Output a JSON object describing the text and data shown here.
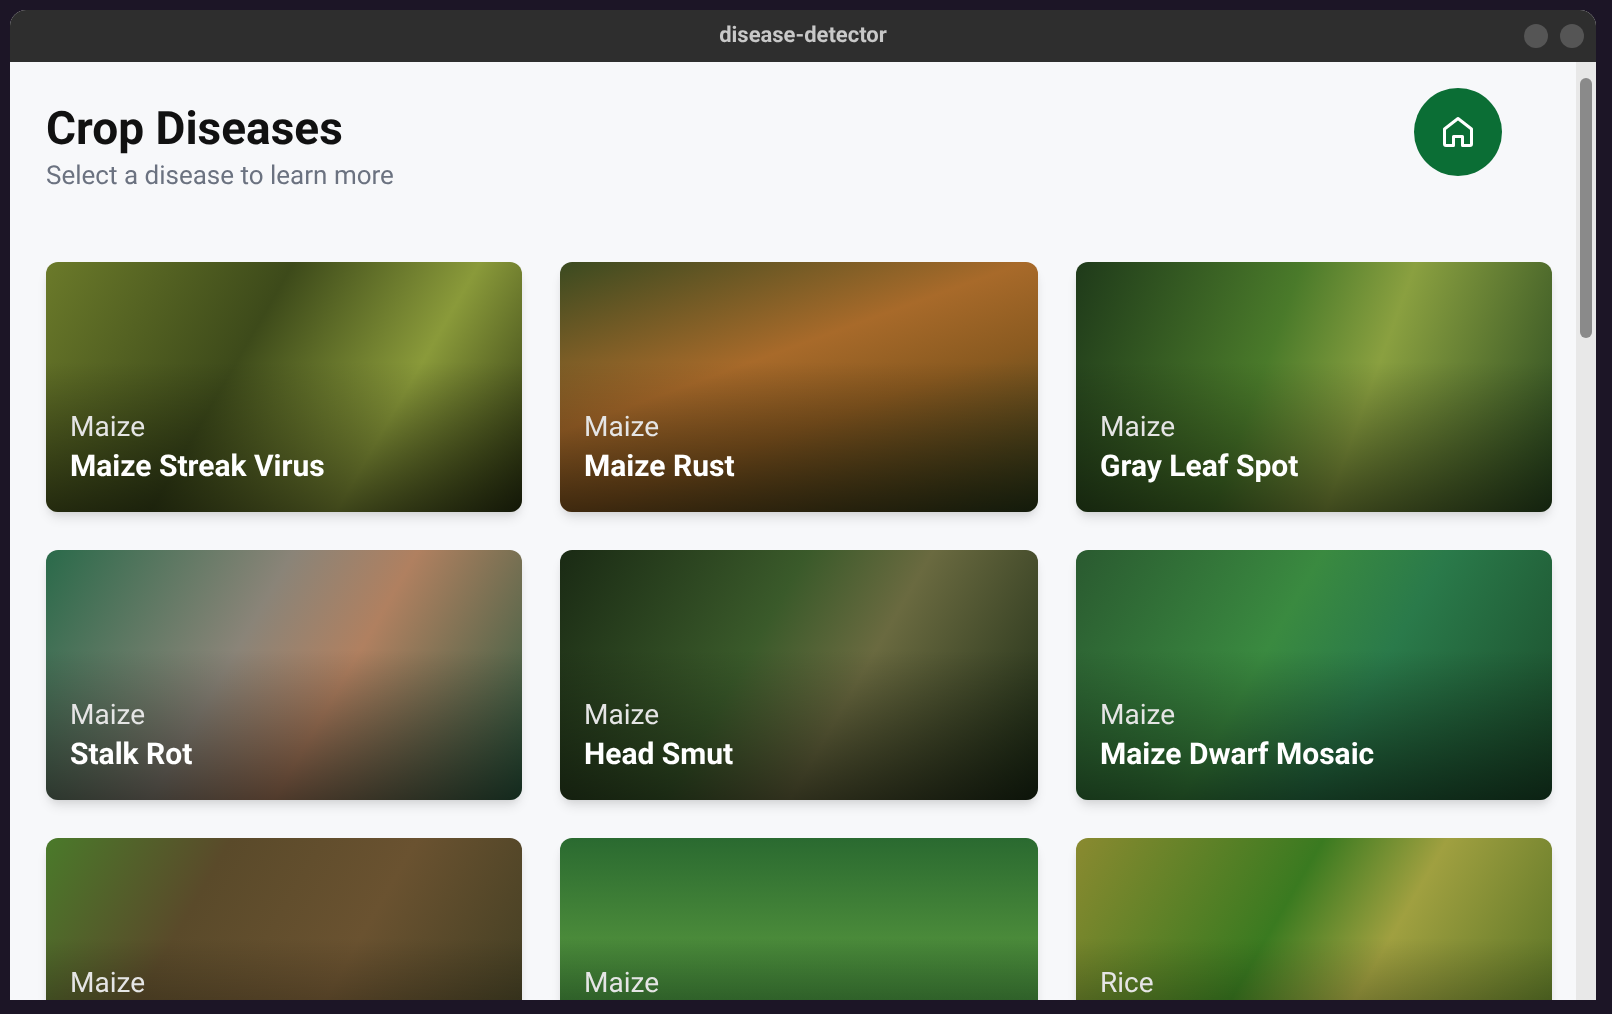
{
  "window": {
    "title": "disease-detector"
  },
  "header": {
    "title": "Crop Diseases",
    "subtitle": "Select a disease to learn more"
  },
  "cards": [
    {
      "crop": "Maize",
      "name": "Maize Streak Virus"
    },
    {
      "crop": "Maize",
      "name": "Maize Rust"
    },
    {
      "crop": "Maize",
      "name": "Gray Leaf Spot"
    },
    {
      "crop": "Maize",
      "name": "Stalk Rot"
    },
    {
      "crop": "Maize",
      "name": "Head Smut"
    },
    {
      "crop": "Maize",
      "name": "Maize Dwarf Mosaic"
    },
    {
      "crop": "Maize"
    },
    {
      "crop": "Maize"
    },
    {
      "crop": "Rice"
    }
  ]
}
